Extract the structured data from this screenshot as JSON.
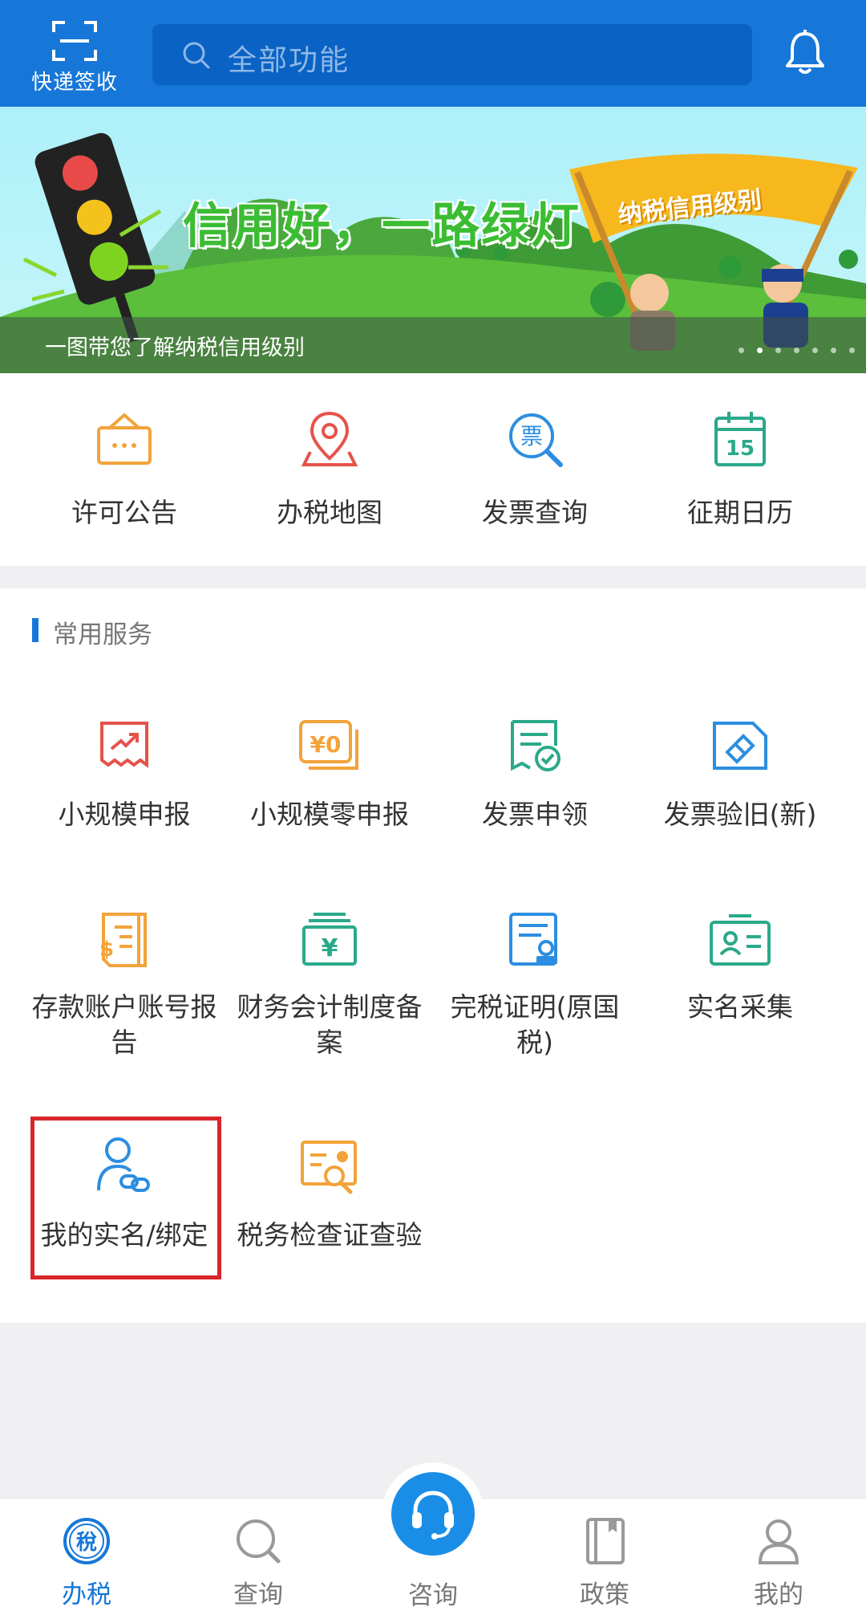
{
  "header": {
    "scan_label": "快递签收",
    "search_placeholder": "全部功能"
  },
  "banner": {
    "headline": "信用好，一路绿灯",
    "flag_text": "纳税信用级别",
    "caption": "一图带您了解纳税信用级别",
    "slide_count": 7,
    "active_slide": 2
  },
  "quick_entries": [
    {
      "label": "许可公告",
      "icon": "announcement-icon"
    },
    {
      "label": "办税地图",
      "icon": "map-pin-icon"
    },
    {
      "label": "发票查询",
      "icon": "invoice-search-icon"
    },
    {
      "label": "征期日历",
      "icon": "calendar-icon"
    }
  ],
  "services": {
    "title": "常用服务",
    "items": [
      {
        "label": "小规模申报",
        "icon": "trend-report-icon"
      },
      {
        "label": "小规模零申报",
        "icon": "zero-yen-icon"
      },
      {
        "label": "发票申领",
        "icon": "invoice-apply-icon"
      },
      {
        "label": "发票验旧(新)",
        "icon": "ticket-verify-icon"
      },
      {
        "label": "存款账户账号报告",
        "icon": "dollar-document-icon"
      },
      {
        "label": "财务会计制度备案",
        "icon": "yen-box-icon"
      },
      {
        "label": "完税证明(原国税)",
        "icon": "stamp-certificate-icon"
      },
      {
        "label": "实名采集",
        "icon": "id-card-icon"
      },
      {
        "label": "我的实名/绑定",
        "icon": "user-link-icon"
      },
      {
        "label": "税务检查证查验",
        "icon": "certificate-search-icon"
      }
    ]
  },
  "bottom_nav": [
    {
      "label": "办税",
      "icon": "tax-icon",
      "active": true
    },
    {
      "label": "查询",
      "icon": "search-icon",
      "active": false
    },
    {
      "label": "咨询",
      "icon": "headset-icon",
      "active": false
    },
    {
      "label": "政策",
      "icon": "book-icon",
      "active": false
    },
    {
      "label": "我的",
      "icon": "user-icon",
      "active": false
    }
  ],
  "colors": {
    "primary": "#1677d8",
    "orange": "#f2a33a",
    "red": "#e5534b",
    "teal": "#2aa98b",
    "blue": "#2c8ee0",
    "highlight": "#d9262b"
  }
}
